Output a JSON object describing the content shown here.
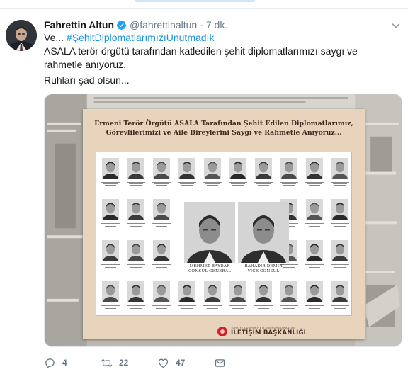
{
  "tweet": {
    "author_name": "Fahrettin Altun",
    "handle": "@fahrettinaltun",
    "separator": "·",
    "time": "7 dk.",
    "text_prefix": "Ve... ",
    "hashtag": "#ŞehitDiplomatlarımızıUnutmadık",
    "text_line2": "ASALA terör örgütü tarafından katledilen şehit diplomatlarımızı saygı ve rahmetle anıyoruz.",
    "text_line3": "Ruhları şad olsun...",
    "icons": {
      "verified": "verified-badge-icon",
      "caret": "chevron-down-icon",
      "reply": "reply-icon",
      "retweet": "retweet-icon",
      "like": "heart-icon",
      "dm": "envelope-icon"
    },
    "stats": {
      "replies": "4",
      "retweets": "22",
      "likes": "47"
    }
  },
  "media": {
    "poster_title_line1": "Ermeni Terör Örgütü ASALA Tarafından Şehit Edilen Diplomatlarımız,",
    "poster_title_line2": "Görevlilerimizi ve Aile Bireylerini Saygı ve Rahmetle Anıyoruz...",
    "featured": [
      {
        "name": "MEHMET BAYDAR",
        "role": "CONSUL GENERAL"
      },
      {
        "name": "BAHADIR DEMIR",
        "role": "VICE CONSUL"
      }
    ],
    "logo_subtitle": "TÜRKİYE CUMHURİYETİ CUMHURBAŞKANLIĞI",
    "logo_title": "İLETİŞİM BAŞKANLIĞI"
  },
  "colors": {
    "text": "#14171a",
    "secondary": "#657786",
    "link": "#1b95e0",
    "verified": "#1da1f2",
    "poster_bg": "#e8d4bd",
    "logo_red": "#d61f26"
  }
}
